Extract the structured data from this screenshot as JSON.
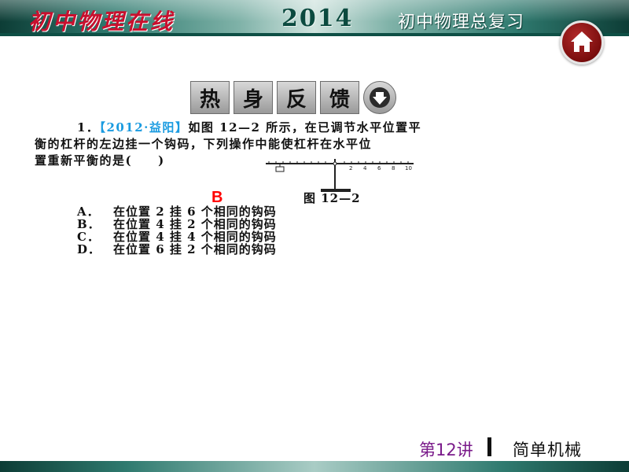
{
  "header": {
    "brand": "初中物理在线",
    "year": "2014",
    "subtitle": "初中物理总复习"
  },
  "banner": {
    "chars": [
      "热",
      "身",
      "反",
      "馈"
    ]
  },
  "question": {
    "number": "1．",
    "source": "【2012·益阳】",
    "line1": "如图 12—2 所示，在已调节水平位置平",
    "line2": "衡的杠杆的左边挂一个钩码，下列操作中能使杠杆在水平位",
    "line3": "置重新平衡的是(　　)"
  },
  "figure": {
    "caption": "图 12—2",
    "tick_labels": [
      "2",
      "4",
      "6",
      "8",
      "10"
    ]
  },
  "answer": "B",
  "options": [
    {
      "key": "A．",
      "text": "在位置 2 挂 6 个相同的钩码"
    },
    {
      "key": "B．",
      "text": "在位置 4 挂 2 个相同的钩码"
    },
    {
      "key": "C．",
      "text": "在位置 4 挂 4 个相同的钩码"
    },
    {
      "key": "D．",
      "text": "在位置 6 挂 2 个相同的钩码"
    }
  ],
  "footer": {
    "chapter": "第12讲",
    "topic": "简单机械"
  }
}
